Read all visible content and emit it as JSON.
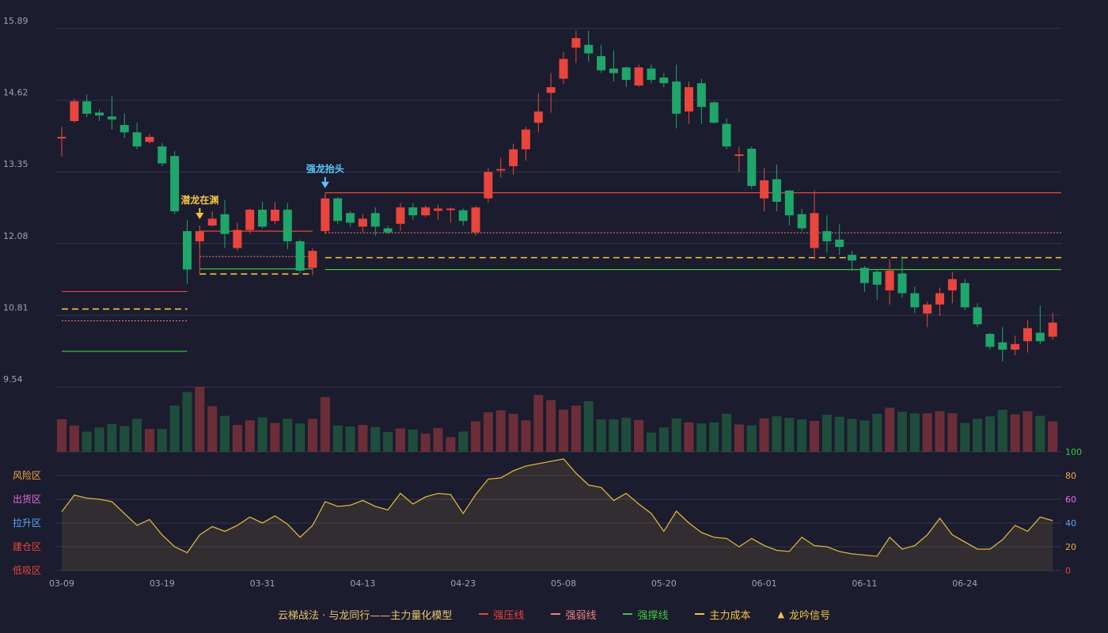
{
  "chart_data": {
    "type": "candlestick",
    "x_labels": [
      "03-09",
      "03-19",
      "03-31",
      "04-13",
      "04-23",
      "05-08",
      "05-20",
      "06-01",
      "06-11",
      "06-24"
    ],
    "x_label_indices": [
      0,
      8,
      16,
      24,
      32,
      40,
      48,
      56,
      64,
      72
    ],
    "y_ticks": [
      "15.89",
      "14.62",
      "13.35",
      "12.08",
      "10.81",
      "9.54"
    ],
    "y_range": [
      9.54,
      15.89
    ],
    "candles": [
      [
        13.97,
        13.97,
        14.15,
        13.62
      ],
      [
        14.25,
        14.6,
        14.65,
        14.22
      ],
      [
        14.6,
        14.38,
        14.72,
        14.32
      ],
      [
        14.4,
        14.35,
        14.45,
        14.25
      ],
      [
        14.33,
        14.28,
        14.7,
        14.1
      ],
      [
        14.18,
        14.05,
        14.38,
        13.95
      ],
      [
        14.05,
        13.8,
        14.22,
        13.75
      ],
      [
        13.88,
        13.97,
        14.02,
        13.85
      ],
      [
        13.8,
        13.5,
        13.86,
        13.45
      ],
      [
        13.63,
        12.65,
        13.72,
        12.6
      ],
      [
        12.3,
        11.62,
        12.5,
        11.37
      ],
      [
        12.12,
        12.3,
        12.4,
        11.98
      ],
      [
        12.4,
        12.52,
        12.65,
        12.38
      ],
      [
        12.6,
        12.25,
        12.85,
        12.0
      ],
      [
        12.0,
        12.32,
        12.45,
        11.95
      ],
      [
        12.32,
        12.68,
        12.7,
        12.25
      ],
      [
        12.68,
        12.38,
        12.82,
        12.35
      ],
      [
        12.48,
        12.68,
        12.82,
        12.42
      ],
      [
        12.68,
        12.12,
        12.8,
        11.98
      ],
      [
        12.12,
        11.6,
        12.15,
        11.55
      ],
      [
        11.65,
        11.95,
        12.0,
        11.52
      ],
      [
        12.3,
        12.88,
        12.95,
        12.25
      ],
      [
        12.88,
        12.48,
        12.9,
        12.42
      ],
      [
        12.62,
        12.45,
        12.65,
        12.38
      ],
      [
        12.38,
        12.52,
        12.6,
        12.28
      ],
      [
        12.62,
        12.38,
        12.72,
        12.22
      ],
      [
        12.35,
        12.28,
        12.4,
        12.25
      ],
      [
        12.43,
        12.72,
        12.8,
        12.3
      ],
      [
        12.72,
        12.58,
        12.8,
        12.5
      ],
      [
        12.58,
        12.72,
        12.75,
        12.55
      ],
      [
        12.66,
        12.7,
        12.77,
        12.5
      ],
      [
        12.68,
        12.7,
        12.72,
        12.45
      ],
      [
        12.67,
        12.48,
        12.7,
        12.4
      ],
      [
        12.28,
        12.72,
        12.75,
        12.22
      ],
      [
        12.88,
        13.35,
        13.42,
        12.8
      ],
      [
        13.38,
        13.4,
        13.6,
        13.25
      ],
      [
        13.45,
        13.75,
        13.85,
        13.3
      ],
      [
        13.75,
        14.1,
        14.15,
        13.55
      ],
      [
        14.22,
        14.42,
        14.75,
        14.05
      ],
      [
        14.75,
        14.85,
        15.1,
        14.4
      ],
      [
        15.0,
        15.35,
        15.48,
        14.9
      ],
      [
        15.55,
        15.72,
        15.85,
        15.28
      ],
      [
        15.6,
        15.45,
        15.85,
        15.3
      ],
      [
        15.4,
        15.15,
        15.6,
        15.1
      ],
      [
        15.18,
        15.1,
        15.5,
        14.95
      ],
      [
        15.2,
        14.98,
        15.22,
        14.85
      ],
      [
        14.88,
        15.2,
        15.25,
        14.85
      ],
      [
        15.18,
        14.98,
        15.25,
        14.92
      ],
      [
        15.02,
        14.92,
        15.1,
        14.85
      ],
      [
        14.95,
        14.38,
        15.25,
        14.12
      ],
      [
        14.42,
        14.85,
        14.95,
        14.2
      ],
      [
        14.92,
        14.5,
        15.0,
        14.2
      ],
      [
        14.58,
        14.22,
        14.6,
        14.2
      ],
      [
        14.2,
        13.8,
        14.3,
        13.75
      ],
      [
        13.65,
        13.66,
        13.8,
        13.35
      ],
      [
        13.76,
        13.1,
        13.8,
        13.05
      ],
      [
        12.88,
        13.2,
        13.42,
        12.65
      ],
      [
        13.22,
        12.82,
        13.48,
        12.65
      ],
      [
        13.02,
        12.58,
        13.02,
        12.4
      ],
      [
        12.6,
        12.35,
        12.7,
        12.3
      ],
      [
        12.0,
        12.62,
        13.02,
        11.8
      ],
      [
        12.3,
        12.12,
        12.58,
        11.92
      ],
      [
        12.15,
        12.02,
        12.42,
        11.88
      ],
      [
        11.88,
        11.78,
        11.95,
        11.6
      ],
      [
        11.65,
        11.38,
        11.68,
        11.22
      ],
      [
        11.58,
        11.35,
        11.62,
        11.08
      ],
      [
        11.25,
        11.6,
        11.8,
        11.0
      ],
      [
        11.55,
        11.2,
        11.85,
        11.12
      ],
      [
        11.2,
        10.95,
        11.32,
        10.85
      ],
      [
        10.84,
        11.0,
        11.05,
        10.6
      ],
      [
        11.0,
        11.2,
        11.3,
        10.8
      ],
      [
        11.25,
        11.45,
        11.58,
        11.02
      ],
      [
        11.38,
        10.95,
        11.45,
        10.9
      ],
      [
        10.95,
        10.65,
        11.02,
        10.6
      ],
      [
        10.48,
        10.25,
        10.5,
        10.2
      ],
      [
        10.33,
        10.2,
        10.6,
        9.99
      ],
      [
        10.2,
        10.3,
        10.45,
        10.1
      ],
      [
        10.35,
        10.58,
        10.72,
        10.15
      ],
      [
        10.5,
        10.35,
        10.98,
        10.3
      ],
      [
        10.43,
        10.68,
        10.85,
        10.38
      ]
    ],
    "volumes": [
      64,
      52,
      40,
      48,
      55,
      51,
      65,
      45,
      45,
      91,
      118,
      128,
      90,
      71,
      53,
      62,
      68,
      57,
      65,
      56,
      65,
      108,
      52,
      50,
      53,
      49,
      39,
      46,
      44,
      36,
      47,
      29,
      40,
      60,
      78,
      82,
      75,
      62,
      112,
      102,
      83,
      91,
      100,
      64,
      64,
      67,
      63,
      38,
      48,
      66,
      58,
      56,
      58,
      75,
      54,
      52,
      66,
      70,
      67,
      64,
      61,
      73,
      69,
      65,
      62,
      75,
      87,
      79,
      76,
      76,
      80,
      76,
      57,
      65,
      70,
      83,
      74,
      80,
      71,
      60
    ],
    "indicator": [
      49.5,
      63.5,
      61,
      60,
      58,
      48,
      38,
      43,
      30,
      20,
      15,
      30,
      37,
      33,
      38,
      45,
      40,
      46,
      39,
      28,
      38,
      58,
      54,
      55,
      59,
      54,
      51,
      65,
      56,
      62,
      65,
      64,
      48,
      64,
      77,
      78,
      84,
      88,
      90,
      92,
      94,
      82,
      72,
      70,
      59,
      65,
      56,
      48,
      33,
      50,
      40,
      32,
      28,
      27,
      20,
      27,
      21,
      17,
      16,
      28,
      21,
      20,
      16,
      14,
      13,
      12,
      28,
      18,
      21,
      30,
      44,
      30,
      24,
      18,
      18,
      26,
      38,
      33,
      45,
      42
    ],
    "indicator_axis": [
      "100",
      "80",
      "60",
      "40",
      "20",
      "0"
    ],
    "zones": [
      "风险区",
      "出货区",
      "拉升区",
      "建仓区",
      "低吸区"
    ],
    "levels": [
      {
        "type": "resist",
        "start": 0,
        "end": 10,
        "value": 11.23
      },
      {
        "type": "cost",
        "start": 0,
        "end": 10,
        "value": 10.92
      },
      {
        "type": "weak",
        "start": 0,
        "end": 10,
        "value": 10.71
      },
      {
        "type": "support",
        "start": 0,
        "end": 10,
        "value": 10.17
      },
      {
        "type": "resist",
        "start": 11,
        "end": 20,
        "value": 12.3
      },
      {
        "type": "weak",
        "start": 11,
        "end": 20,
        "value": 11.85
      },
      {
        "type": "support",
        "start": 11,
        "end": 20,
        "value": 11.63
      },
      {
        "type": "cost",
        "start": 11,
        "end": 20,
        "value": 11.54
      },
      {
        "type": "resist",
        "start": 21,
        "end": 79,
        "value": 12.98
      },
      {
        "type": "weak",
        "start": 21,
        "end": 79,
        "value": 12.27
      },
      {
        "type": "cost",
        "start": 21,
        "end": 79,
        "value": 11.83
      },
      {
        "type": "support",
        "start": 21,
        "end": 79,
        "value": 11.62
      }
    ],
    "signals": [
      {
        "index": 11,
        "label": "潜龙在渊",
        "color": "#f4c542"
      },
      {
        "index": 21,
        "label": "强龙抬头",
        "color": "#5bc7ff"
      }
    ],
    "colors": {
      "up": "#e8453c",
      "down": "#1fa66a",
      "resist": "#e8453c",
      "weak": "#f08080",
      "support": "#3cc83c",
      "cost": "#f4c542"
    }
  },
  "legend": {
    "title": "云梯战法 · 与龙同行——主力量化模型",
    "items": [
      {
        "label": "强压线",
        "color": "#e8453c",
        "style": "solid"
      },
      {
        "label": "强弱线",
        "color": "#f08080",
        "style": "dashed"
      },
      {
        "label": "强撑线",
        "color": "#3cc83c",
        "style": "solid"
      },
      {
        "label": "主力成本",
        "color": "#f4c542",
        "style": "dashed"
      },
      {
        "label": "龙吟信号",
        "color": "#f4c542",
        "style": "triangle"
      }
    ]
  }
}
